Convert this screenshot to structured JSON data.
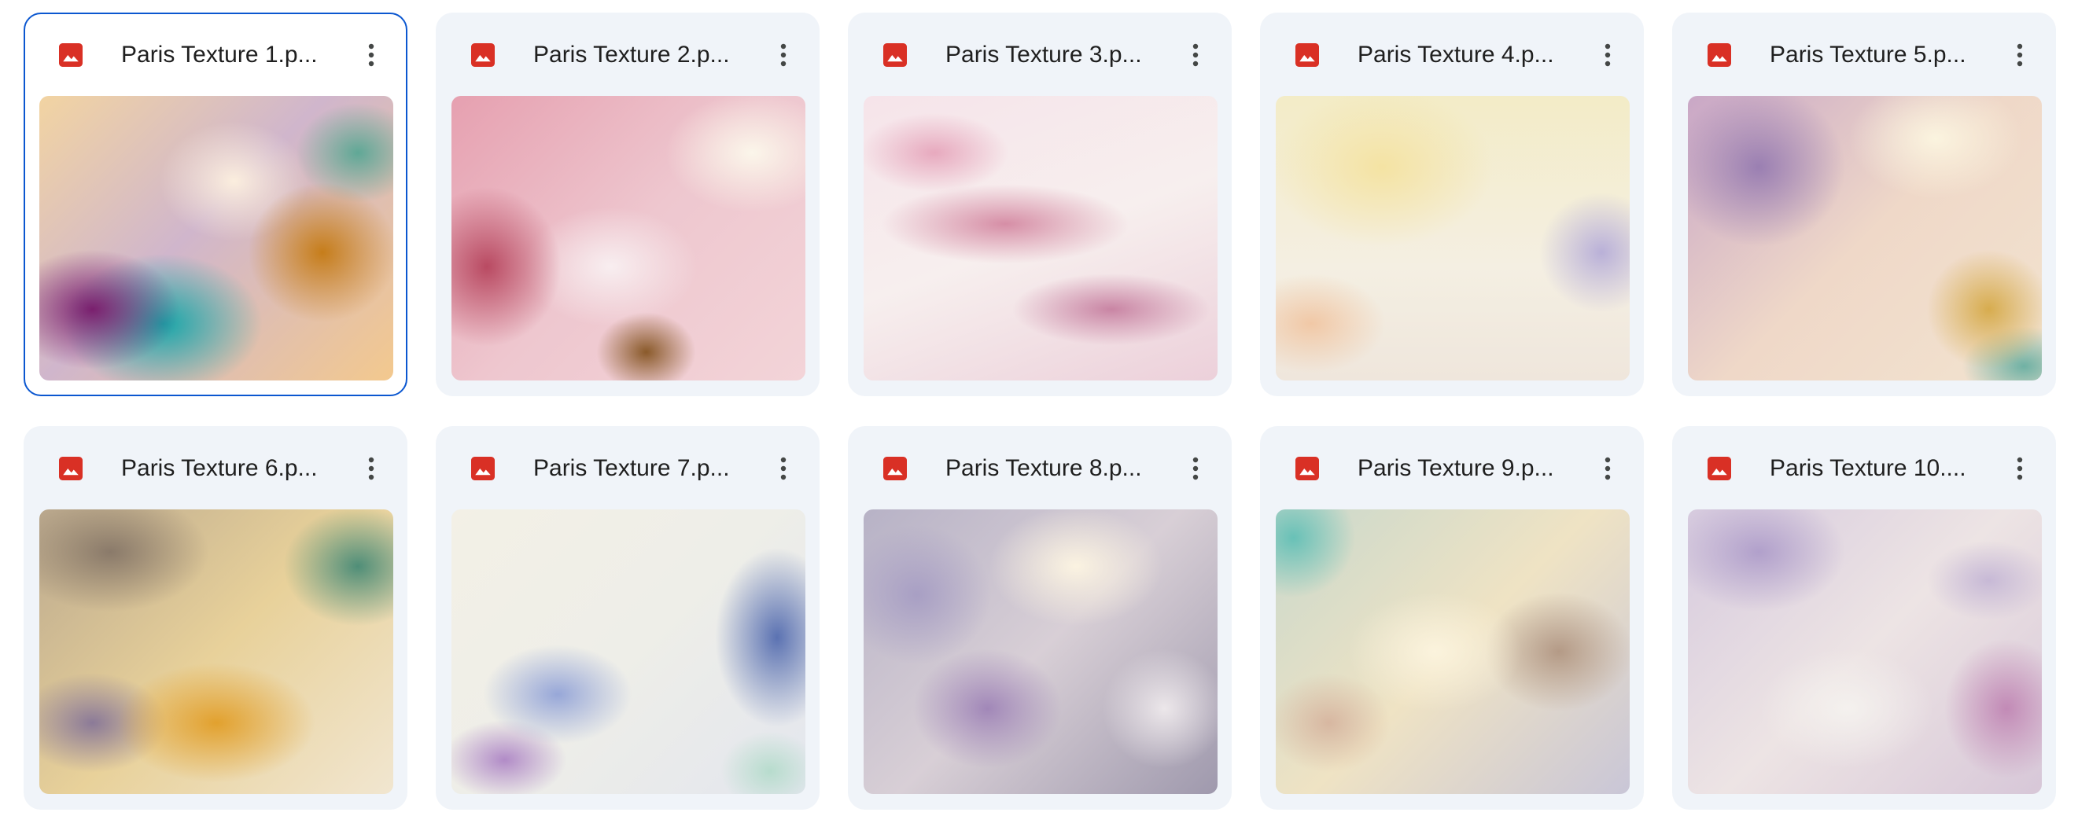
{
  "files": [
    {
      "name": "Paris Texture 1.p...",
      "icon": "image-file-icon",
      "selected": true
    },
    {
      "name": "Paris Texture 2.p...",
      "icon": "image-file-icon",
      "selected": false
    },
    {
      "name": "Paris Texture 3.p...",
      "icon": "image-file-icon",
      "selected": false
    },
    {
      "name": "Paris Texture 4.p...",
      "icon": "image-file-icon",
      "selected": false
    },
    {
      "name": "Paris Texture 5.p...",
      "icon": "image-file-icon",
      "selected": false
    },
    {
      "name": "Paris Texture 6.p...",
      "icon": "image-file-icon",
      "selected": false
    },
    {
      "name": "Paris Texture 7.p...",
      "icon": "image-file-icon",
      "selected": false
    },
    {
      "name": "Paris Texture 8.p...",
      "icon": "image-file-icon",
      "selected": false
    },
    {
      "name": "Paris Texture 9.p...",
      "icon": "image-file-icon",
      "selected": false
    },
    {
      "name": "Paris Texture 10....",
      "icon": "image-file-icon",
      "selected": false
    }
  ],
  "colors": {
    "card_background": "#f0f4f9",
    "selected_border": "#0b57d0",
    "image_icon_red": "#d93025",
    "text": "#1f1f1f",
    "more_icon": "#444746"
  }
}
